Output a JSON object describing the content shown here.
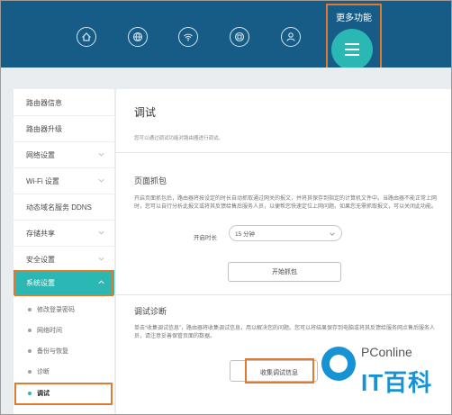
{
  "header": {
    "more_label": "更多功能",
    "nav_icons": [
      "home-icon",
      "globe-icon",
      "wifi-icon",
      "network-icon",
      "user-icon"
    ],
    "menu_icon": "hamburger-icon"
  },
  "colors": {
    "header_bg": "#165c87",
    "accent": "#2bb7b3",
    "highlight_border": "#e07a2f",
    "watermark_blue": "#1793d3"
  },
  "sidebar": {
    "items": [
      {
        "label": "路由器信息"
      },
      {
        "label": "路由器升级"
      },
      {
        "label": "网络设置"
      },
      {
        "label": "Wi-Fi 设置"
      },
      {
        "label": "动态域名服务 DDNS"
      },
      {
        "label": "存储共享"
      },
      {
        "label": "安全设置"
      },
      {
        "label": "系统设置"
      }
    ],
    "subitems": [
      {
        "label": "修改登录密码"
      },
      {
        "label": "网络时间"
      },
      {
        "label": "备份与恢复"
      },
      {
        "label": "诊断"
      },
      {
        "label": "调试"
      }
    ]
  },
  "main": {
    "title": "调试",
    "subtitle": "您可以通过调试功能对路由器进行调试。",
    "capture": {
      "title": "页面抓包",
      "description": "开启页面抓包后，路由器将按设定的时长自动抓取通过网关的报文，并将其保存到指定的计算机文件中。当路由器不能正常上网时，您可以自行分析此报文或将其反馈给售后服务人员，以便帮您快速定位上网问题。如果您无需抓取报文，可以关闭此功能。",
      "duration_label": "开启时长",
      "duration_value": "15 分钟",
      "start_button": "开始抓包"
    },
    "debug": {
      "title": "调试诊断",
      "description": "单击“收集调试信息”，路由器将收集调试信息，用以解决您的问题。您可以将结果保存到电脑或将其反馈给服务网点售后服务人员，请注意妥善保管页面的数据。",
      "collect_button": "收集调试信息"
    }
  },
  "watermark": {
    "brand": "PConline",
    "text": "IT百科"
  }
}
